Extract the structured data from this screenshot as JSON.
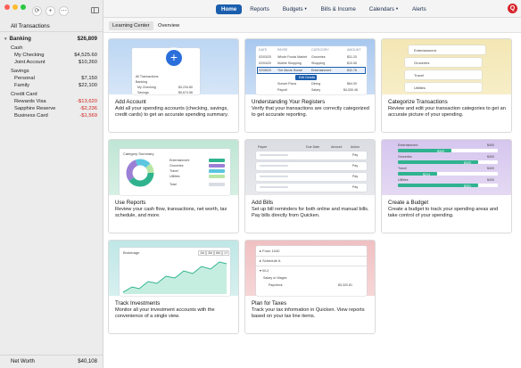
{
  "sidebar": {
    "all_transactions": "All Transactions",
    "banking": {
      "label": "Banking",
      "total": "$26,809"
    },
    "groups": [
      {
        "label": "Cash",
        "accounts": [
          {
            "name": "My Checking",
            "balance": "$4,525.60"
          },
          {
            "name": "Joint Account",
            "balance": "$10,260"
          }
        ]
      },
      {
        "label": "Savings",
        "accounts": [
          {
            "name": "Personal",
            "balance": "$7,150"
          },
          {
            "name": "Family",
            "balance": "$22,100"
          }
        ]
      },
      {
        "label": "Credit Card",
        "accounts": [
          {
            "name": "Rewards Visa",
            "balance": "-$13,620"
          },
          {
            "name": "Sapphire Reserve",
            "balance": "-$2,236"
          },
          {
            "name": "Business Card",
            "balance": "-$1,569"
          }
        ]
      }
    ],
    "net_worth": {
      "label": "Net Worth",
      "value": "$40,108"
    }
  },
  "nav": {
    "items": [
      "Home",
      "Reports",
      "Budgets",
      "Bills & Income",
      "Calendars",
      "Alerts"
    ],
    "active": "Home",
    "logo": "Q"
  },
  "subtabs": [
    "Learning Center",
    "Overview"
  ],
  "cards": [
    {
      "title": "Add Account",
      "desc": "Add all your spending accounts (checking, savings, credit cards) to get an accurate spending summary."
    },
    {
      "title": "Understanding Your Registers",
      "desc": "Verify that your transactions are correctly categorized to get accurate reporting."
    },
    {
      "title": "Categorize Transactions",
      "desc": "Review and edit your transaction categories to get an accurate picture of your spending."
    },
    {
      "title": "Use Reports",
      "desc": "Review your cash flow, transactions, net worth, tax schedule, and more."
    },
    {
      "title": "Add Bills",
      "desc": "Set up bill reminders for both online and manual bills. Pay bills directly from Quicken."
    },
    {
      "title": "Create a Budget",
      "desc": "Create a budget to track your spending areas and take control of your spending."
    },
    {
      "title": "Track Investments",
      "desc": "Monitor all your investment accounts with the convenience of a single view."
    },
    {
      "title": "Plan for Taxes",
      "desc": "Track your tax information in Quicken. View reports based on your tax line items."
    }
  ],
  "previews": {
    "account": {
      "rows": [
        "All Transactions",
        "Banking",
        "My Checking",
        "Savings"
      ],
      "values": [
        "",
        "",
        "$3,234.80",
        "$9,674.56"
      ]
    },
    "register": {
      "headers": [
        "DATE",
        "PAYEE",
        "CATEGORY",
        "AMOUNT"
      ],
      "rows": [
        {
          "date": "02/03/20",
          "payee": "Whole Foods Market",
          "cat": "Groceries",
          "amt": "$31.20"
        },
        {
          "date": "02/04/20",
          "payee": "Mobile Shopping",
          "cat": "Shopping",
          "amt": "$10.55"
        },
        {
          "date": "02/08/20",
          "payee": "The Movie House",
          "cat": "Entertainment",
          "amt": "$32.76"
        },
        {
          "date": "",
          "payee": "Sunset Pizza",
          "cat": "Dining",
          "amt": "$64.00"
        },
        {
          "date": "",
          "payee": "Payroll",
          "cat": "Salary",
          "amt": "$4,530.46"
        }
      ],
      "edit_label": "Edit Details"
    },
    "categories": [
      "Entertainment",
      "Groceries",
      "Travel",
      "Utilities"
    ],
    "reports": {
      "title": "Category Summary",
      "items": [
        "Entertainment",
        "Groceries",
        "Travel",
        "Utilities",
        "Total"
      ]
    },
    "bills": {
      "headers": [
        "Payee",
        "Due Date",
        "Amount",
        "Action"
      ],
      "action": "Pay"
    },
    "budget": [
      {
        "name": "Entertainment",
        "val": "$400",
        "amt": "$300"
      },
      {
        "name": "Groceries",
        "val": "$400",
        "amt": "$320"
      },
      {
        "name": "Travel",
        "val": "$400",
        "amt": "$214"
      },
      {
        "name": "Utilities",
        "val": "$400",
        "amt": "$321"
      }
    ],
    "brokerage": {
      "title": "Brokerage",
      "ranges": [
        "1M",
        "3M",
        "6M",
        "1Y"
      ]
    },
    "taxes": {
      "items": [
        "Form 1040",
        "Schedule A",
        "W-2"
      ],
      "sub": "Salary or Wages",
      "row": "Paycheck",
      "value": "$3,320.81"
    }
  }
}
